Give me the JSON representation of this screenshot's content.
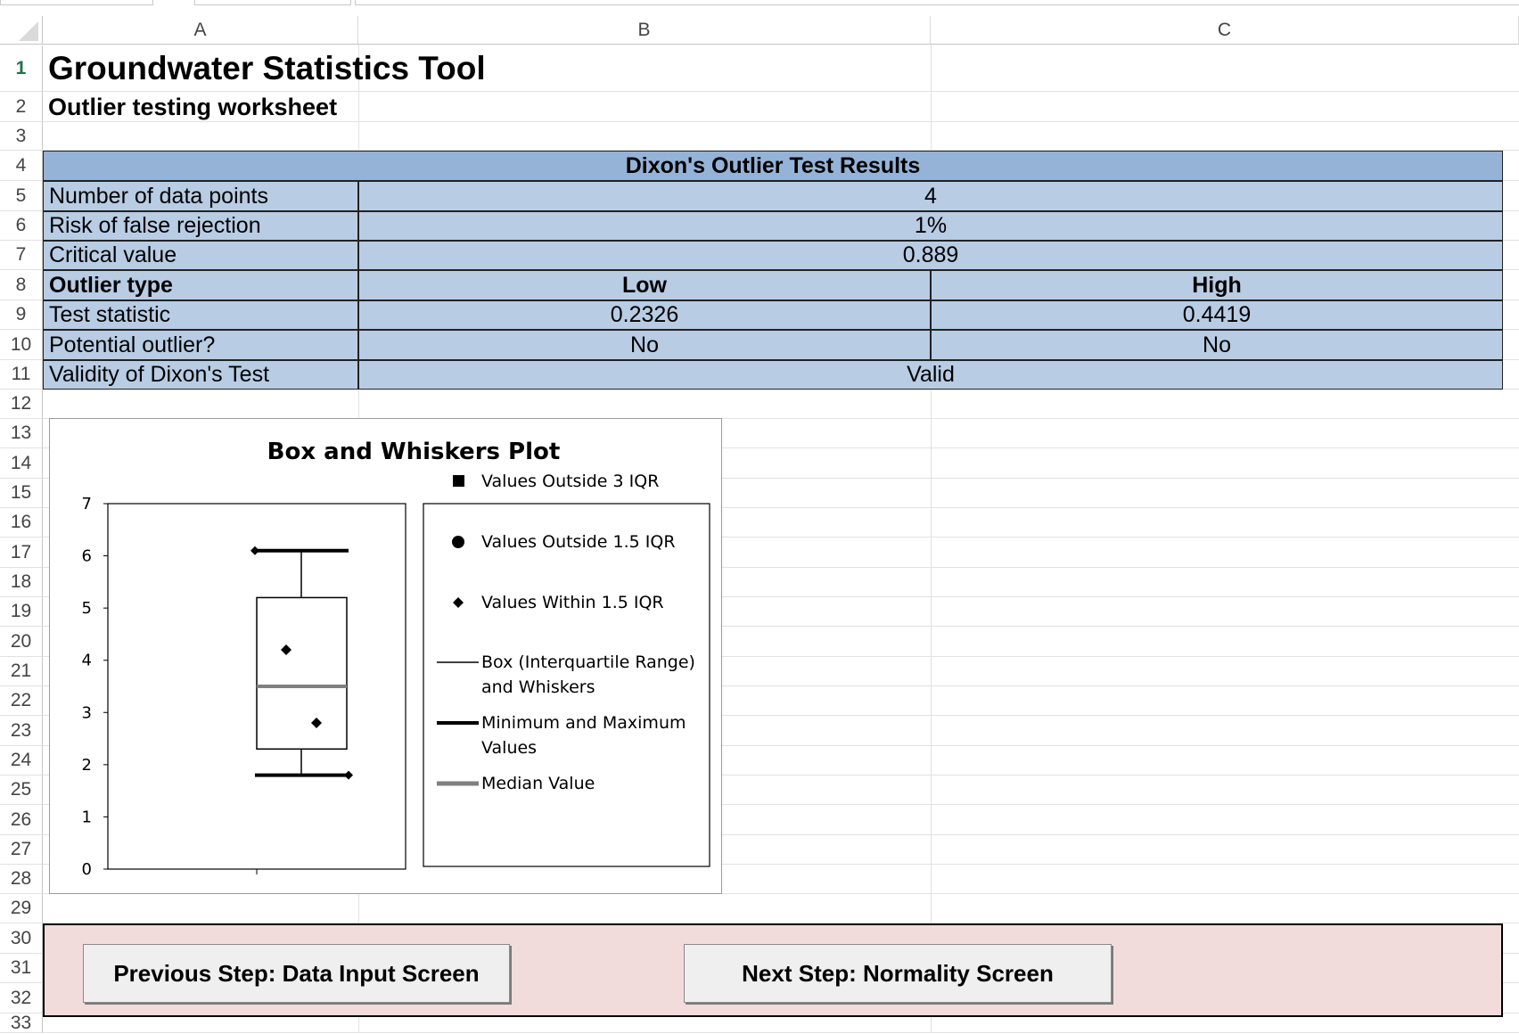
{
  "columns": [
    "A",
    "B",
    "C"
  ],
  "rows": [
    "1",
    "2",
    "3",
    "4",
    "5",
    "6",
    "7",
    "8",
    "9",
    "10",
    "11",
    "12",
    "13",
    "14",
    "15",
    "16",
    "17",
    "18",
    "19",
    "20",
    "21",
    "22",
    "23",
    "24",
    "25",
    "26",
    "27",
    "28",
    "29",
    "30",
    "31",
    "32",
    "33"
  ],
  "active_row": "1",
  "sheet": {
    "title": "Groundwater Statistics Tool",
    "subtitle": "Outlier testing worksheet"
  },
  "results": {
    "header": "Dixon's Outlier Test Results",
    "rows": [
      {
        "label": "Number of data points",
        "value": "4"
      },
      {
        "label": "Risk of false rejection",
        "value": "1%"
      },
      {
        "label": "Critical value",
        "value": "0.889"
      }
    ],
    "outlier_type": {
      "label": "Outlier type",
      "low": "Low",
      "high": "High"
    },
    "test_statistic": {
      "label": "Test statistic",
      "low": "0.2326",
      "high": "0.4419"
    },
    "potential_outlier": {
      "label": "Potential outlier?",
      "low": "No",
      "high": "No"
    },
    "validity": {
      "label": "Validity of Dixon's Test",
      "value": "Valid"
    }
  },
  "chart_data": {
    "type": "box",
    "title": "Box and Whiskers Plot",
    "ylim": [
      0,
      7
    ],
    "yticks": [
      "0",
      "1",
      "2",
      "3",
      "4",
      "5",
      "6",
      "7"
    ],
    "min": 1.8,
    "q1": 2.3,
    "median": 3.5,
    "q3": 5.2,
    "max": 6.1,
    "points_within_1_5_iqr": [
      4.2,
      2.8
    ],
    "points_outside_1_5_iqr": [],
    "points_outside_3_iqr": [],
    "legend": [
      {
        "symbol": "square",
        "lines": [
          "Values Outside 3 IQR"
        ]
      },
      {
        "symbol": "circle",
        "lines": [
          "Values Outside 1.5 IQR"
        ]
      },
      {
        "symbol": "diamond",
        "lines": [
          "Values Within 1.5 IQR"
        ]
      },
      {
        "symbol": "thin-line",
        "lines": [
          "Box (Interquartile Range)",
          "and Whiskers"
        ]
      },
      {
        "symbol": "thick-line",
        "lines": [
          "Minimum and Maximum",
          "Values"
        ]
      },
      {
        "symbol": "gray-line",
        "lines": [
          "Median Value"
        ]
      }
    ],
    "legend_position": "right",
    "colors": {
      "median": "#808080",
      "box": "#000000"
    }
  },
  "buttons": {
    "previous": "Previous Step: Data Input Screen",
    "next": "Next Step:  Normality Screen"
  },
  "colors": {
    "header_fill": "#95b3d7",
    "table_fill": "#b8cce4",
    "nav_fill": "#f2dcdb",
    "active_row_header": "#217346"
  }
}
